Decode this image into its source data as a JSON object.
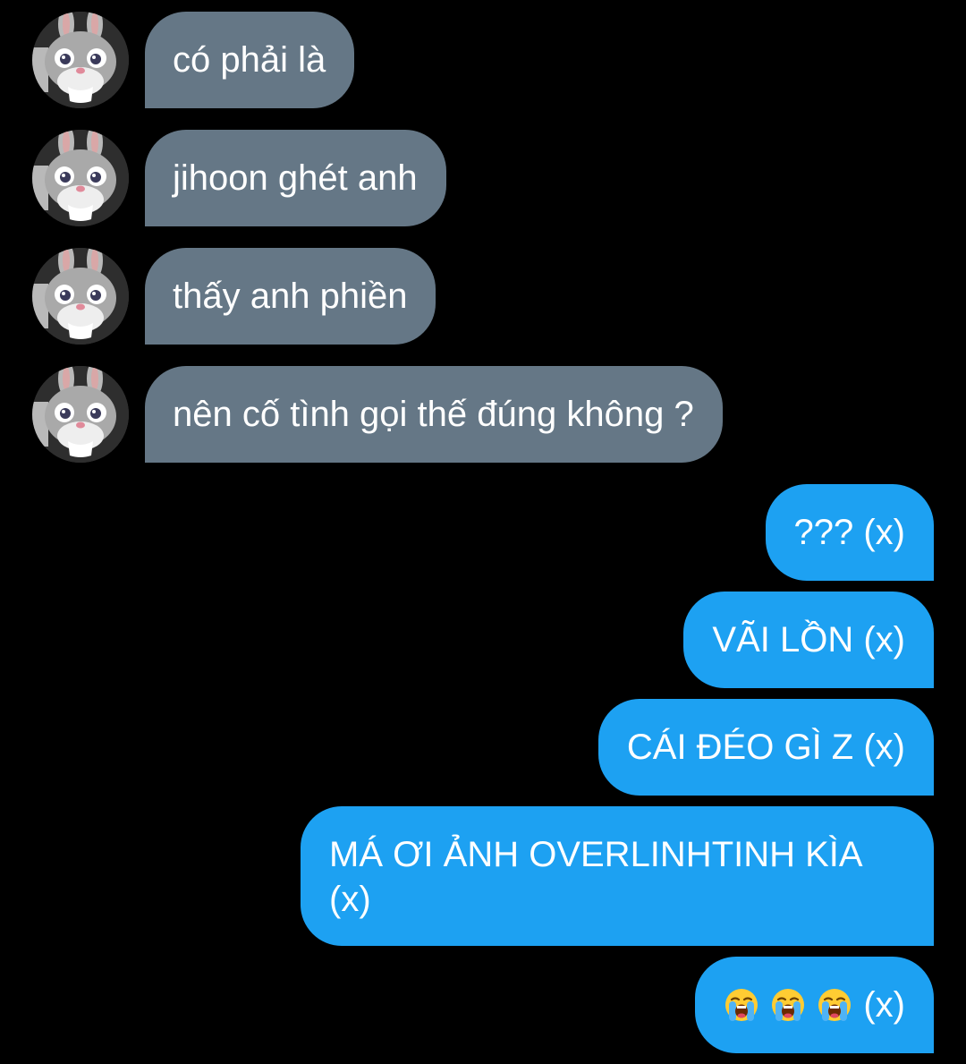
{
  "contact": {
    "avatar_icon": "bunny-mascot-avatar-icon"
  },
  "messages": [
    {
      "side": "incoming",
      "text": "có phải là"
    },
    {
      "side": "incoming",
      "text": "jihoon ghét anh"
    },
    {
      "side": "incoming",
      "text": "thấy anh phiền"
    },
    {
      "side": "incoming",
      "text": "nên cố tình gọi thế đúng không ?"
    },
    {
      "side": "outgoing",
      "text": "??? (x)"
    },
    {
      "side": "outgoing",
      "text": "VÃI LỒN (x)"
    },
    {
      "side": "outgoing",
      "text": "CÁI ĐÉO GÌ Z (x)"
    },
    {
      "side": "outgoing",
      "text": "MÁ ƠI ẢNH OVERLINHTINH KÌA (x)"
    },
    {
      "side": "outgoing",
      "emoji": [
        "loudly-crying-face-emoji",
        "loudly-crying-face-emoji",
        "loudly-crying-face-emoji"
      ],
      "text": "(x)"
    }
  ],
  "colors": {
    "background": "#000000",
    "incoming_bubble": "#657786",
    "outgoing_bubble": "#1da1f2",
    "text": "#ffffff"
  }
}
